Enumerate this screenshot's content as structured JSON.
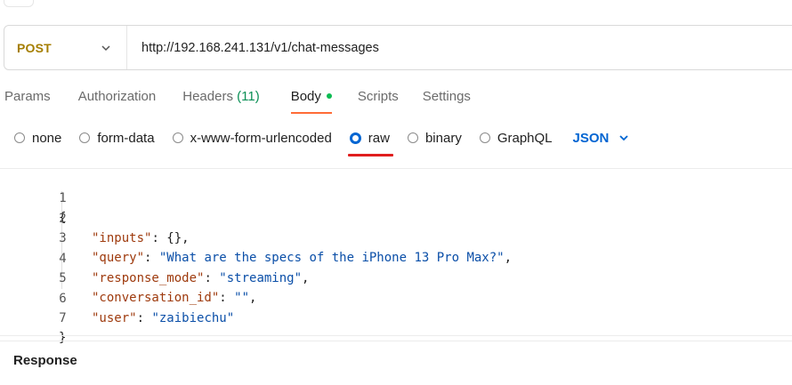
{
  "request": {
    "method": "POST",
    "url": "http://192.168.241.131/v1/chat-messages"
  },
  "tabs": [
    {
      "label": "Params"
    },
    {
      "label": "Authorization"
    },
    {
      "label": "Headers",
      "count": "(11)"
    },
    {
      "label": "Body"
    },
    {
      "label": "Scripts"
    },
    {
      "label": "Settings"
    }
  ],
  "body_types": [
    {
      "label": "none",
      "selected": false
    },
    {
      "label": "form-data",
      "selected": false
    },
    {
      "label": "x-www-form-urlencoded",
      "selected": false
    },
    {
      "label": "raw",
      "selected": true
    },
    {
      "label": "binary",
      "selected": false
    },
    {
      "label": "GraphQL",
      "selected": false
    }
  ],
  "language": "JSON",
  "editor": {
    "line_numbers": [
      "1",
      "2",
      "3",
      "4",
      "5",
      "6",
      "7"
    ],
    "open_brace": "{",
    "close_brace": "}",
    "fields": [
      {
        "key": "\"inputs\"",
        "value": "{}",
        "trail": ","
      },
      {
        "key": "\"query\"",
        "value": "\"What are the specs of the iPhone 13 Pro Max?\"",
        "trail": ","
      },
      {
        "key": "\"response_mode\"",
        "value": "\"streaming\"",
        "trail": ","
      },
      {
        "key": "\"conversation_id\"",
        "value": "\"\"",
        "trail": ","
      },
      {
        "key": "\"user\"",
        "value": "\"zaibiechu\"",
        "trail": ""
      }
    ]
  },
  "response_label": "Response",
  "colors": {
    "method": "#a57e00",
    "accent_blue": "#0265d2",
    "tab_underline": "#ff6c37",
    "selection_underline": "#e01e1e",
    "json_key": "#9e3a0d",
    "json_string": "#0b4fa8"
  }
}
